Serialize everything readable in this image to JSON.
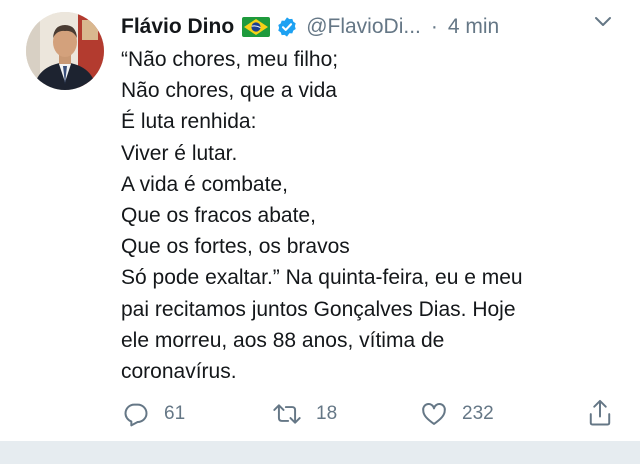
{
  "tweet": {
    "author": {
      "name": "Flávio Dino",
      "handle": "@FlavioDi...",
      "separator": "·",
      "time": "4 min"
    },
    "icons": {
      "flag": "brazil-flag-icon",
      "verified": "verified-badge-icon",
      "menu": "chevron-down-icon"
    },
    "text_lines": [
      "“Não chores, meu filho;",
      "Não chores, que a vida",
      "É luta renhida:",
      "Viver é lutar.",
      "A vida é combate,",
      "Que os fracos abate,",
      "Que os fortes, os bravos",
      "Só pode exaltar.” Na quinta-feira, eu e meu",
      "pai recitamos juntos Gonçalves Dias. Hoje",
      "ele morreu, aos 88 anos, vítima de",
      "coronavírus."
    ],
    "actions": {
      "replies": "61",
      "retweets": "18",
      "likes": "232"
    }
  },
  "colors": {
    "text": "#14171a",
    "secondary": "#657786",
    "verified": "#1da1f2",
    "divider": "#e6ecf0"
  }
}
